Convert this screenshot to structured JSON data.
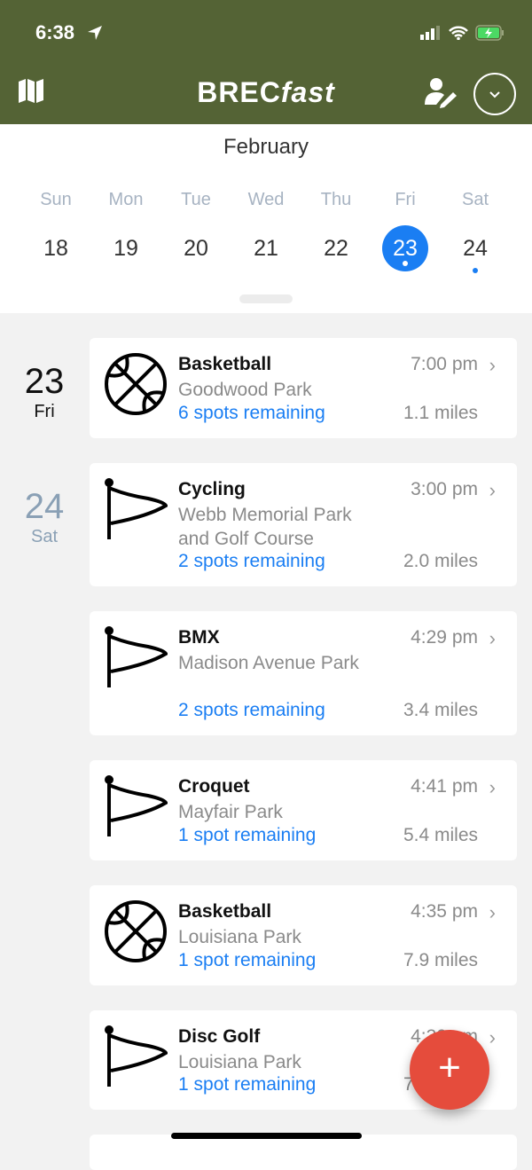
{
  "status": {
    "time": "6:38"
  },
  "header": {
    "logo_bold": "BREC",
    "logo_italic": "fast"
  },
  "calendar": {
    "month": "February",
    "days": [
      {
        "name": "Sun",
        "num": "18"
      },
      {
        "name": "Mon",
        "num": "19"
      },
      {
        "name": "Tue",
        "num": "20"
      },
      {
        "name": "Wed",
        "num": "21"
      },
      {
        "name": "Thu",
        "num": "22"
      },
      {
        "name": "Fri",
        "num": "23",
        "selected": true
      },
      {
        "name": "Sat",
        "num": "24"
      }
    ]
  },
  "groups": [
    {
      "num": "23",
      "day": "Fri"
    },
    {
      "num": "24",
      "day": "Sat"
    }
  ],
  "events": [
    {
      "title": "Basketball",
      "place": "Goodwood Park",
      "spots": "6 spots remaining",
      "time": "7:00 pm",
      "distance": "1.1 miles",
      "icon": "basketball"
    },
    {
      "title": "Cycling",
      "place": "Webb Memorial Park and Golf Course",
      "spots": "2 spots remaining",
      "time": "3:00 pm",
      "distance": "2.0 miles",
      "icon": "flag"
    },
    {
      "title": "BMX",
      "place": "Madison Avenue Park",
      "spots": "2 spots remaining",
      "time": "4:29 pm",
      "distance": "3.4 miles",
      "icon": "flag"
    },
    {
      "title": "Croquet",
      "place": "Mayfair Park",
      "spots": "1 spot remaining",
      "time": "4:41 pm",
      "distance": "5.4 miles",
      "icon": "flag"
    },
    {
      "title": "Basketball",
      "place": "Louisiana Park",
      "spots": "1 spot remaining",
      "time": "4:35 pm",
      "distance": "7.9 miles",
      "icon": "basketball"
    },
    {
      "title": "Disc Golf",
      "place": "Louisiana Park",
      "spots": "1 spot remaining",
      "time": "4:30 pm",
      "distance": "7.9 miles",
      "icon": "flag"
    }
  ],
  "fab": {
    "label": "+"
  },
  "colors": {
    "header": "#546335",
    "accent": "#1a7ef3",
    "fab": "#e54c3c"
  }
}
